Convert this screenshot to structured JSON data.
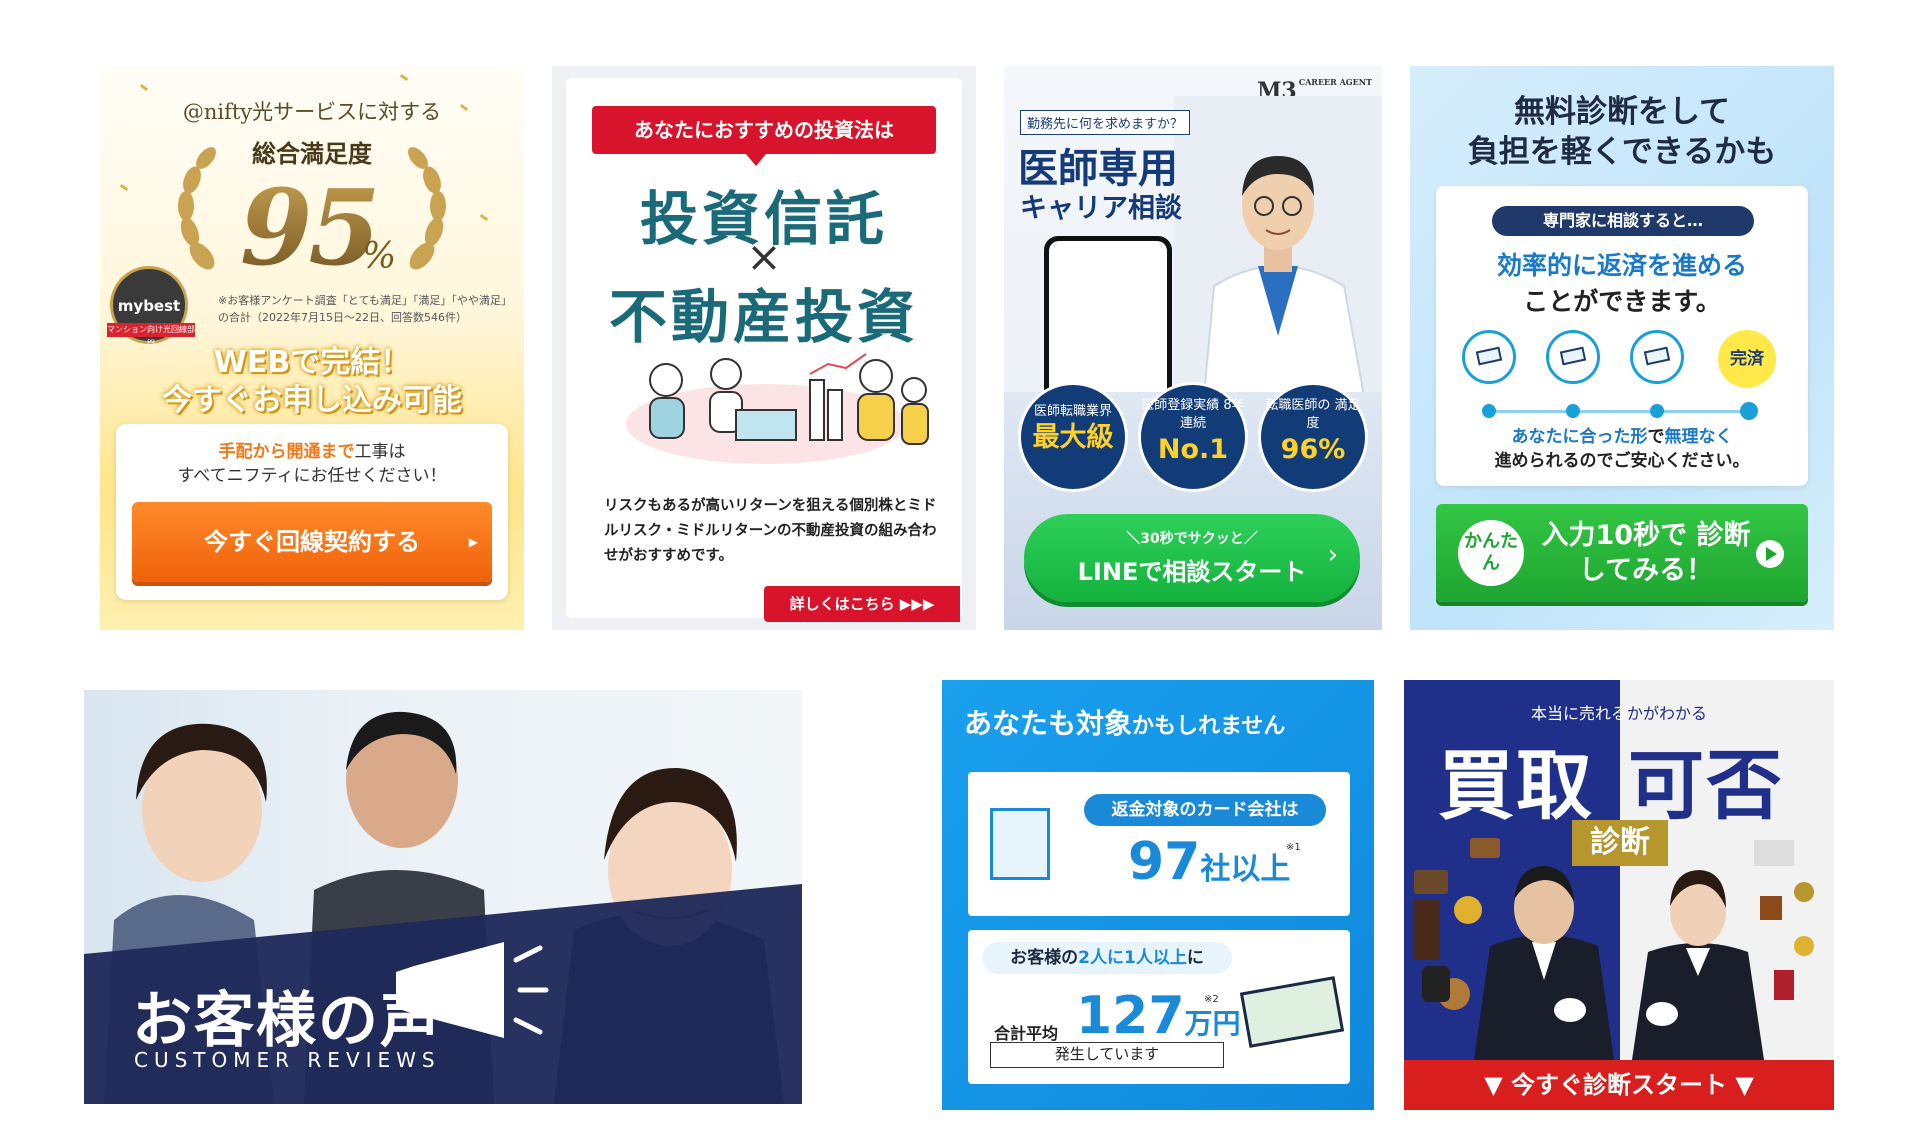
{
  "ads": {
    "nifty": {
      "lead": "@nifty光サービスに対する",
      "sub": "総合満足度",
      "big": "95",
      "pct": "%",
      "badge": "mybest",
      "badge_ribbon": "マンション向け光回線部門",
      "note": "※お客様アンケート調査「とても満足」「満足」「やや満足」の合計（2022年7月15日〜22日、回答数546件）",
      "headline_1": "WEBで完結！",
      "headline_2": "今すぐお申し込み可能",
      "panel_a": "手配から開通まで",
      "panel_b": "工事は",
      "panel_c": "すべてニフティにお任せください！",
      "cta": "今すぐ回線契約する",
      "colors": {
        "accent": "#f07a1a",
        "gold": "#c9a352"
      }
    },
    "investment": {
      "pill": "あなたにおすすめの投資法は",
      "title_1": "投資信託",
      "cross": "×",
      "title_2": "不動産投資",
      "body": "リスクもあるが高いリターンを狙える個別株とミドルリスク・ミドルリターンの不動産投資の組み合わせがおすすめです。",
      "more": "詳しくはこちら ▶▶▶",
      "colors": {
        "accent": "#d8142c",
        "title": "#1a6a7a"
      }
    },
    "m3": {
      "logo": "M3",
      "logo_sub": "CAREER AGENT",
      "question": "勤務先に何を求めますか？",
      "heading_1": "医師専用",
      "heading_2": "キャリア相談",
      "stats": [
        {
          "label": "医師転職業界",
          "value": "最大級"
        },
        {
          "label": "医師登録実績 8年連続",
          "value": "No.1"
        },
        {
          "label": "転職医師の 満足度",
          "value": "96%"
        }
      ],
      "cta_small": "＼30秒でサクッと／",
      "cta": "LINEで相談スタート",
      "colors": {
        "navy": "#123c78",
        "green": "#12b23c"
      }
    },
    "diagnosis": {
      "heading_1": "無料診断をして",
      "heading_2": "負担を軽くできるかも",
      "tag": "専門家に相談すると…",
      "line_1": "効率的に返済を進める",
      "line_2": "ことができます。",
      "done": "完済",
      "line_3a": "あなたに合った形",
      "line_3b": "で",
      "line_3c": "無理なく",
      "line_4": "進められるのでご安心ください。",
      "easy": "かんたん",
      "cta": "入力10秒で 診断してみる！",
      "colors": {
        "blue": "#1a7ac8",
        "green": "#1ea530"
      }
    },
    "reviews": {
      "title": "お客様の声",
      "subtitle": "CUSTOMER REVIEWS",
      "colors": {
        "navy": "#1f2a5a"
      }
    },
    "refund": {
      "heading_a": "あなたも対象",
      "heading_b": "かもしれません",
      "tag_1": "返金対象のカード会社は",
      "num_1": "97",
      "num_1_unit": "社以上",
      "note_1": "※1",
      "tag_2_a": "お客様の",
      "tag_2_b": "2人に1人以上",
      "tag_2_c": "に",
      "label_2": "合計平均",
      "num_2": "127",
      "num_2_unit": "万円",
      "note_2": "※2",
      "occur": "発生しています",
      "colors": {
        "blue": "#1a8ad8"
      }
    },
    "buyback": {
      "top_a": "本当に売れる",
      "top_b": "かがわかる",
      "title_left": "買取",
      "title_right": "可否",
      "shindan": "診断",
      "cta": "▼ 今すぐ診断スタート ▼",
      "colors": {
        "navy": "#1f2f8a",
        "red": "#d91e1e",
        "gold": "#b8962e"
      }
    }
  }
}
